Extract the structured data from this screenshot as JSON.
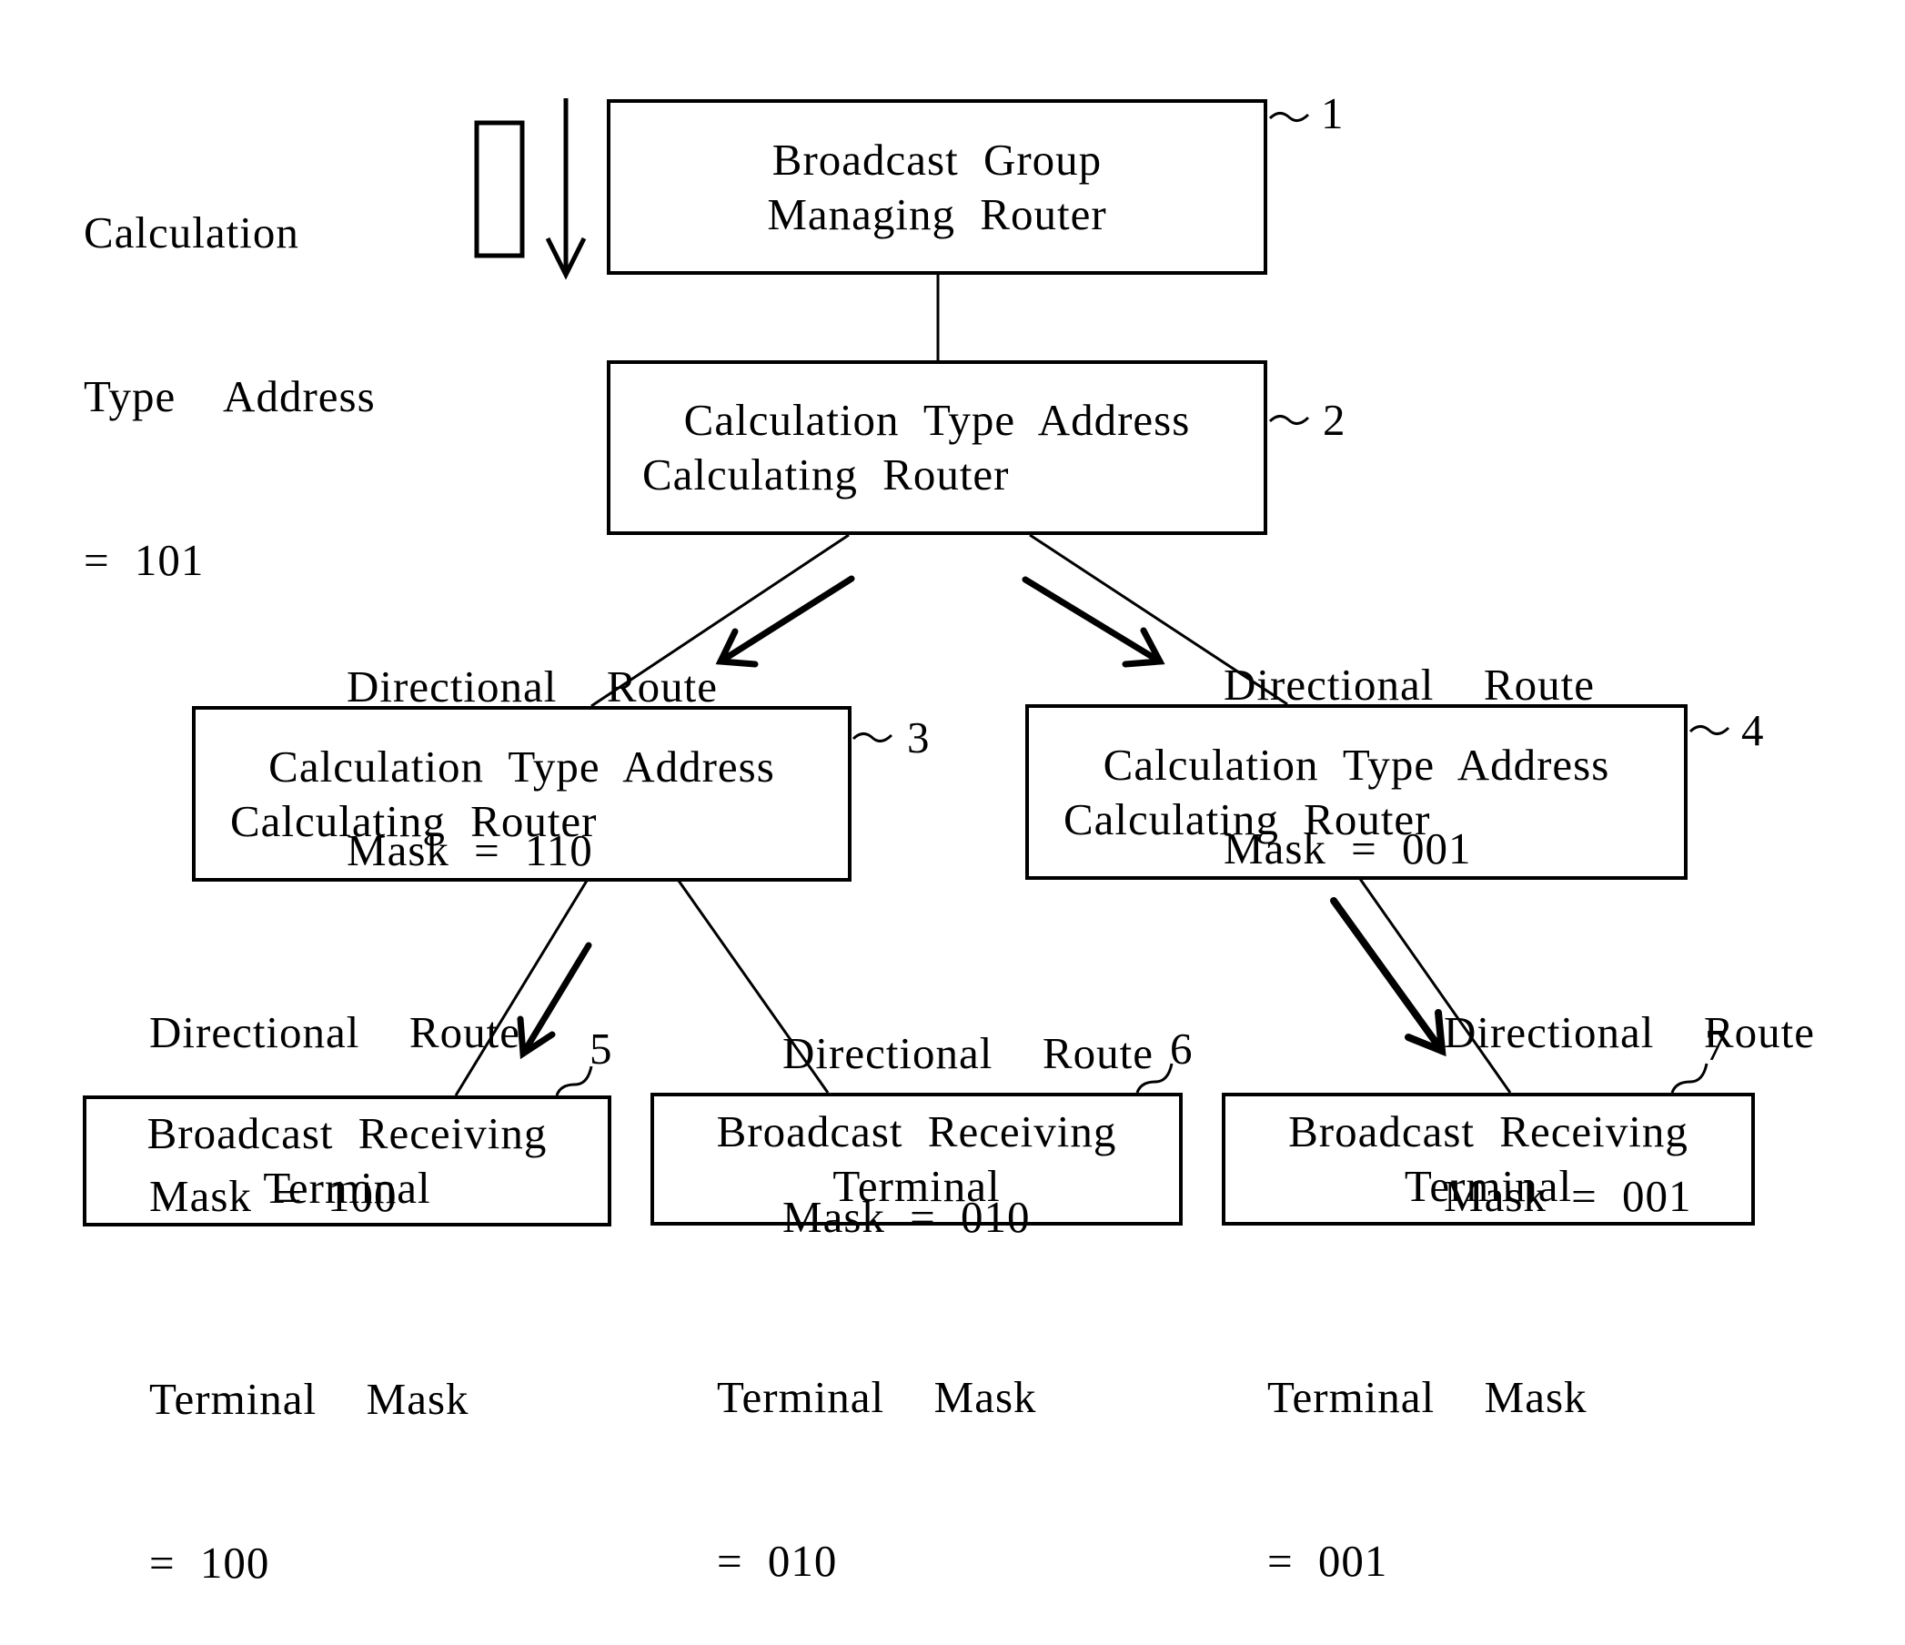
{
  "input_label": {
    "line1": "Calculation",
    "line2": "Type  Address",
    "line3": "= 101"
  },
  "nodes": [
    {
      "id": "1",
      "line1": "Broadcast  Group",
      "line2": "Managing  Router"
    },
    {
      "id": "2",
      "line1": "Calculation  Type  Address",
      "line2": "Calculating  Router"
    },
    {
      "id": "3",
      "line1": "Calculation  Type  Address",
      "line2": "Calculating  Router"
    },
    {
      "id": "4",
      "line1": "Calculation  Type  Address",
      "line2": "Calculating  Router"
    },
    {
      "id": "5",
      "line1": "Broadcast  Receiving",
      "line2": "Terminal"
    },
    {
      "id": "6",
      "line1": "Broadcast  Receiving",
      "line2": "Terminal"
    },
    {
      "id": "7",
      "line1": "Broadcast  Receiving",
      "line2": "Terminal"
    }
  ],
  "route_labels": [
    {
      "line1": "Directional  Route",
      "line2": "Mask = 110"
    },
    {
      "line1": "Directional  Route",
      "line2": "Mask = 001"
    },
    {
      "line1": "Directional  Route",
      "line2": "Mask = 100"
    },
    {
      "line1": "Directional  Route",
      "line2": "Mask = 010"
    },
    {
      "line1": "Directional  Route",
      "line2": "Mask = 001"
    }
  ],
  "terminal_masks": [
    {
      "line1": "Terminal  Mask",
      "line2": "= 100"
    },
    {
      "line1": "Terminal  Mask",
      "line2": "= 010"
    },
    {
      "line1": "Terminal  Mask",
      "line2": "= 001"
    }
  ]
}
